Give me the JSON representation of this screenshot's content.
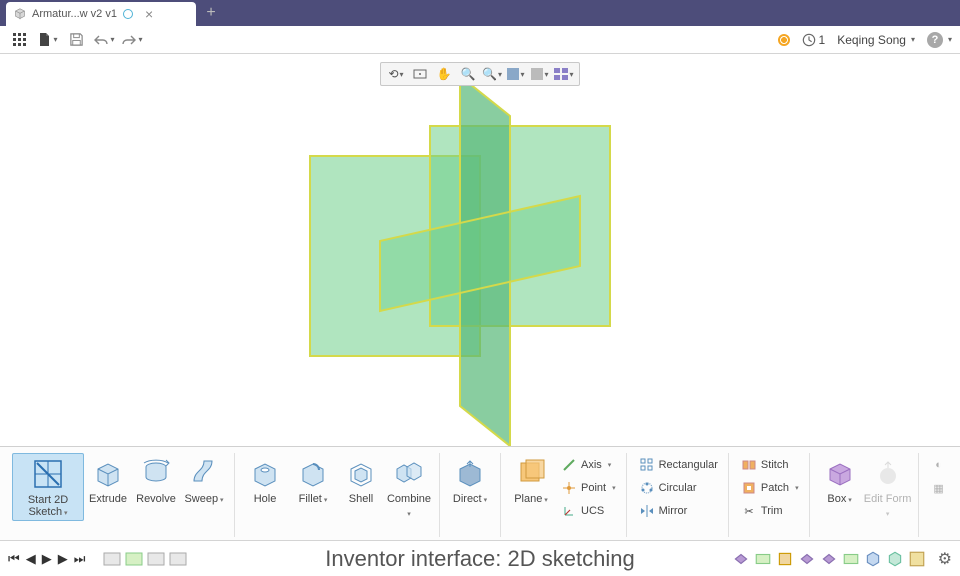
{
  "titlebar": {
    "tab_label": "Armatur...w v2 v1"
  },
  "qa": {
    "user": "Keqing Song",
    "queue": "1"
  },
  "ribbon": {
    "start": {
      "label": "Start 2D Sketch"
    },
    "extrude": "Extrude",
    "revolve": "Revolve",
    "sweep": "Sweep",
    "hole": "Hole",
    "fillet": "Fillet",
    "shell": "Shell",
    "combine": "Combine",
    "direct": "Direct",
    "plane": "Plane",
    "axis": "Axis",
    "point": "Point",
    "ucs": "UCS",
    "rect": "Rectangular",
    "circ": "Circular",
    "mirror": "Mirror",
    "stitch": "Stitch",
    "patch": "Patch",
    "trim": "Trim",
    "box": "Box",
    "editform": "Edit Form"
  },
  "status": {
    "caption": "Inventor interface: 2D sketching"
  }
}
